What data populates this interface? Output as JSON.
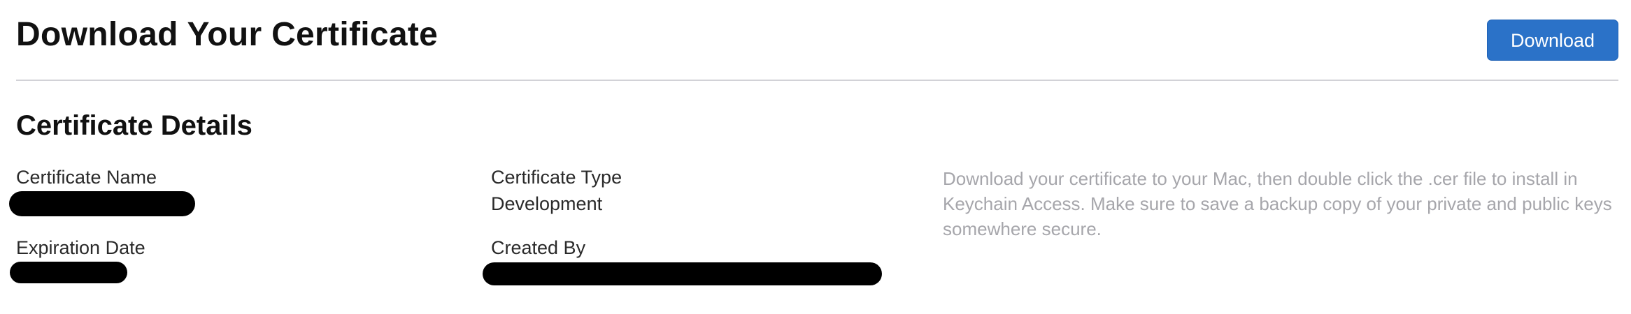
{
  "header": {
    "title": "Download Your Certificate",
    "download_label": "Download"
  },
  "details": {
    "section_title": "Certificate Details",
    "certificate_name": {
      "label": "Certificate Name"
    },
    "expiration_date": {
      "label": "Expiration Date"
    },
    "certificate_type": {
      "label": "Certificate Type",
      "value": "Development"
    },
    "created_by": {
      "label": "Created By"
    },
    "help_text": "Download your certificate to your Mac, then double click the .cer file to install in Keychain Access. Make sure to save a backup copy of your private and public keys somewhere secure."
  },
  "colors": {
    "accent": "#2b72c8",
    "divider": "#d2d2d7",
    "help_text": "#a6a6ab",
    "redaction": "#000000"
  }
}
